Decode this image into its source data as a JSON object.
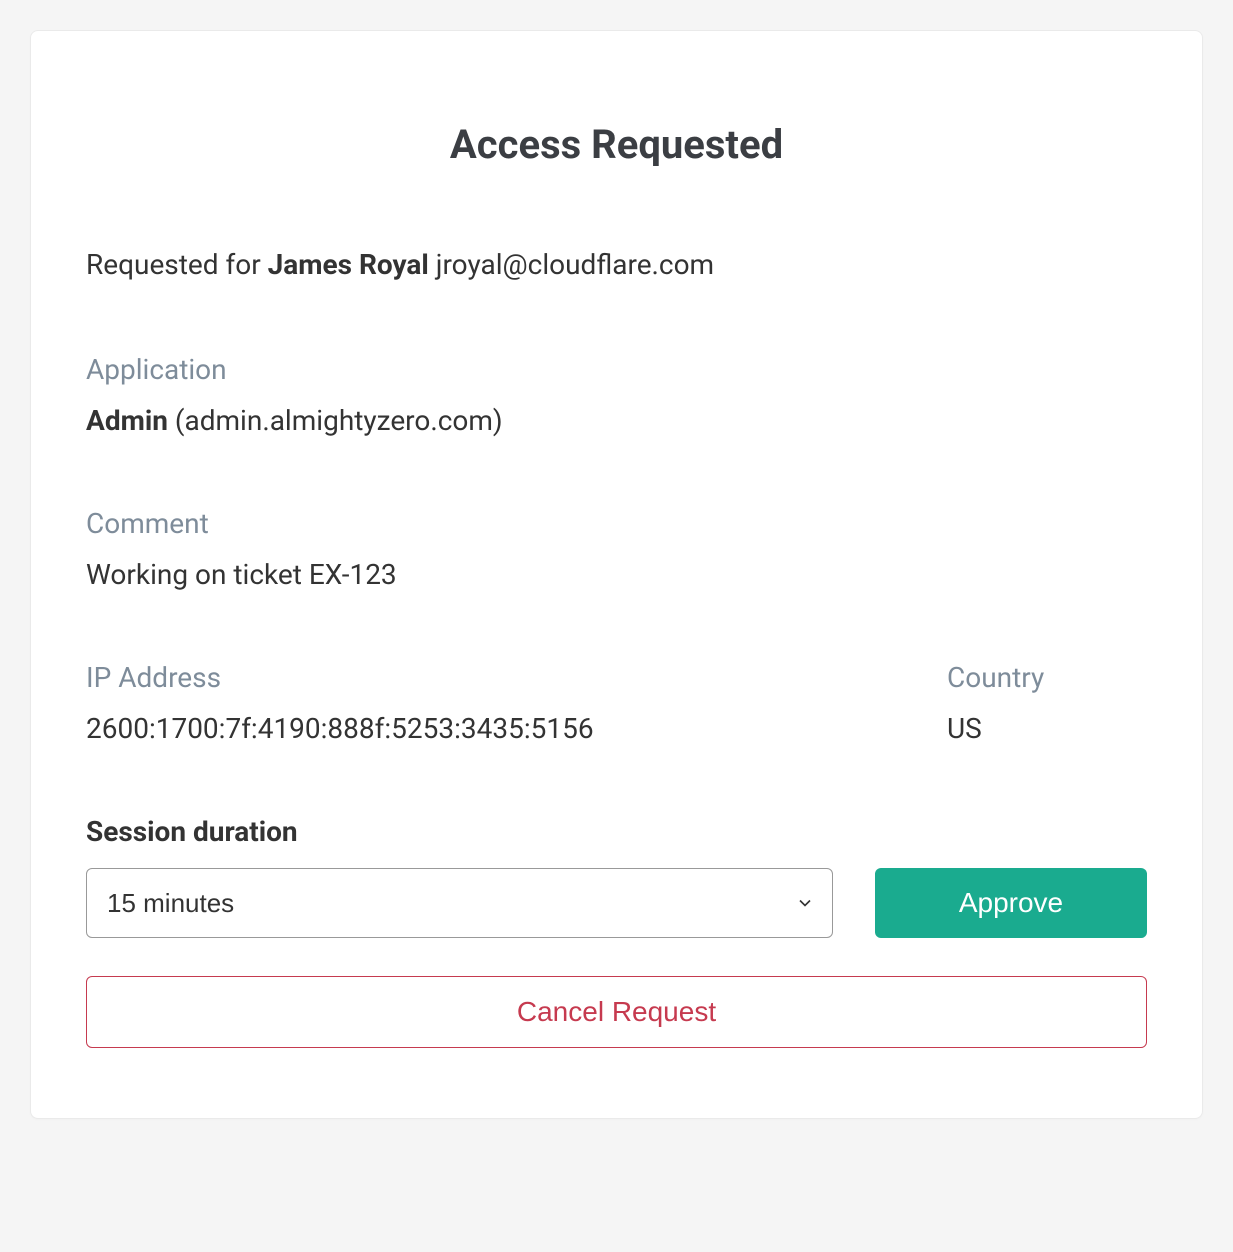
{
  "title": "Access Requested",
  "requested_for_prefix": "Requested for ",
  "requester": {
    "name": "James Royal",
    "email": "jroyal@cloudflare.com"
  },
  "application": {
    "label": "Application",
    "name": "Admin",
    "url": "(admin.almightyzero.com)"
  },
  "comment": {
    "label": "Comment",
    "text": "Working on ticket EX-123"
  },
  "ip": {
    "label": "IP Address",
    "value": "2600:1700:7f:4190:888f:5253:3435:5156"
  },
  "country": {
    "label": "Country",
    "value": "US"
  },
  "session": {
    "label": "Session duration",
    "selected": "15 minutes"
  },
  "actions": {
    "approve": "Approve",
    "cancel": "Cancel Request"
  }
}
